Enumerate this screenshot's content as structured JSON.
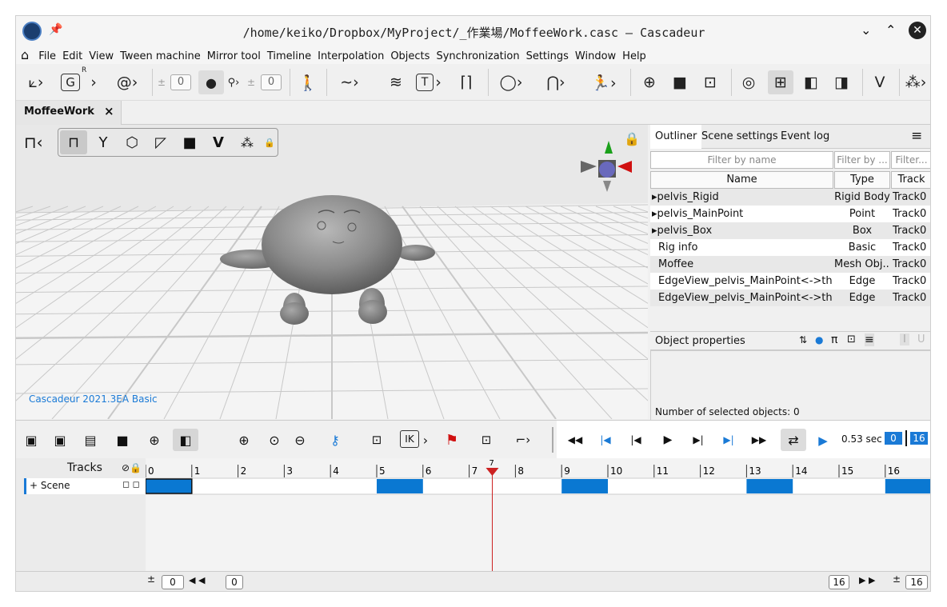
{
  "window": {
    "title": "/home/keiko/Dropbox/MyProject/_作業場/MoffeeWork.casc – Cascadeur"
  },
  "menu": [
    "File",
    "Edit",
    "View",
    "Tween machine",
    "Mirror tool",
    "Timeline",
    "Interpolation",
    "Objects",
    "Synchronization",
    "Settings",
    "Window",
    "Help"
  ],
  "toolbar": {
    "counter1": "0",
    "counter2": "0",
    "glyph_g": "G",
    "glyph_r": "R",
    "glyph_t": "T"
  },
  "tab": {
    "label": "MoffeeWork",
    "close": "×"
  },
  "viewport": {
    "watermark": "Cascadeur 2021.3EA Basic"
  },
  "panel": {
    "tabs": [
      "Outliner",
      "Scene settings",
      "Event log"
    ],
    "filters": [
      "Filter by name",
      "Filter by ...",
      "Filter..."
    ],
    "headers": [
      "Name",
      "Type",
      "Track"
    ],
    "rows": [
      {
        "name": "pelvis_Rigid",
        "type": "Rigid Body",
        "track": "Track0",
        "expand": true
      },
      {
        "name": "pelvis_MainPoint",
        "type": "Point",
        "track": "Track0",
        "expand": true
      },
      {
        "name": "pelvis_Box",
        "type": "Box",
        "track": "Track0",
        "expand": true
      },
      {
        "name": "Rig info",
        "type": "Basic",
        "track": "Track0",
        "expand": false
      },
      {
        "name": "Moffee",
        "type": "Mesh Obj...",
        "track": "Track0",
        "expand": false
      },
      {
        "name": "EdgeView_pelvis_MainPoint<->thigh...",
        "type": "Edge",
        "track": "Track0",
        "expand": false
      },
      {
        "name": "EdgeView_pelvis_MainPoint<->thigh...",
        "type": "Edge",
        "track": "Track0",
        "expand": false
      }
    ],
    "props_title": "Object properties",
    "props_icons": {
      "pi": "π",
      "i": "I",
      "u": "U"
    },
    "selected": "Number of selected objects: 0"
  },
  "timeline": {
    "time": "0.53 sec",
    "frame_start": "0",
    "frame_end": "16",
    "ik": "IK",
    "current_frame": "7",
    "ticks": [
      "0",
      "1",
      "2",
      "3",
      "4",
      "5",
      "6",
      "7",
      "8",
      "9",
      "10",
      "11",
      "12",
      "13",
      "14",
      "15",
      "16"
    ],
    "tracks_label": "Tracks",
    "scene_label": "+ Scene",
    "keyframes": [
      0,
      5,
      9,
      13,
      16
    ]
  },
  "bottom": {
    "left_start": "0",
    "left_pos": "0",
    "right_pos": "16",
    "right_end": "16"
  },
  "colors": {
    "accent": "#0a78d2",
    "playhead": "#cc2222",
    "keyblock": "#0a78d2"
  }
}
